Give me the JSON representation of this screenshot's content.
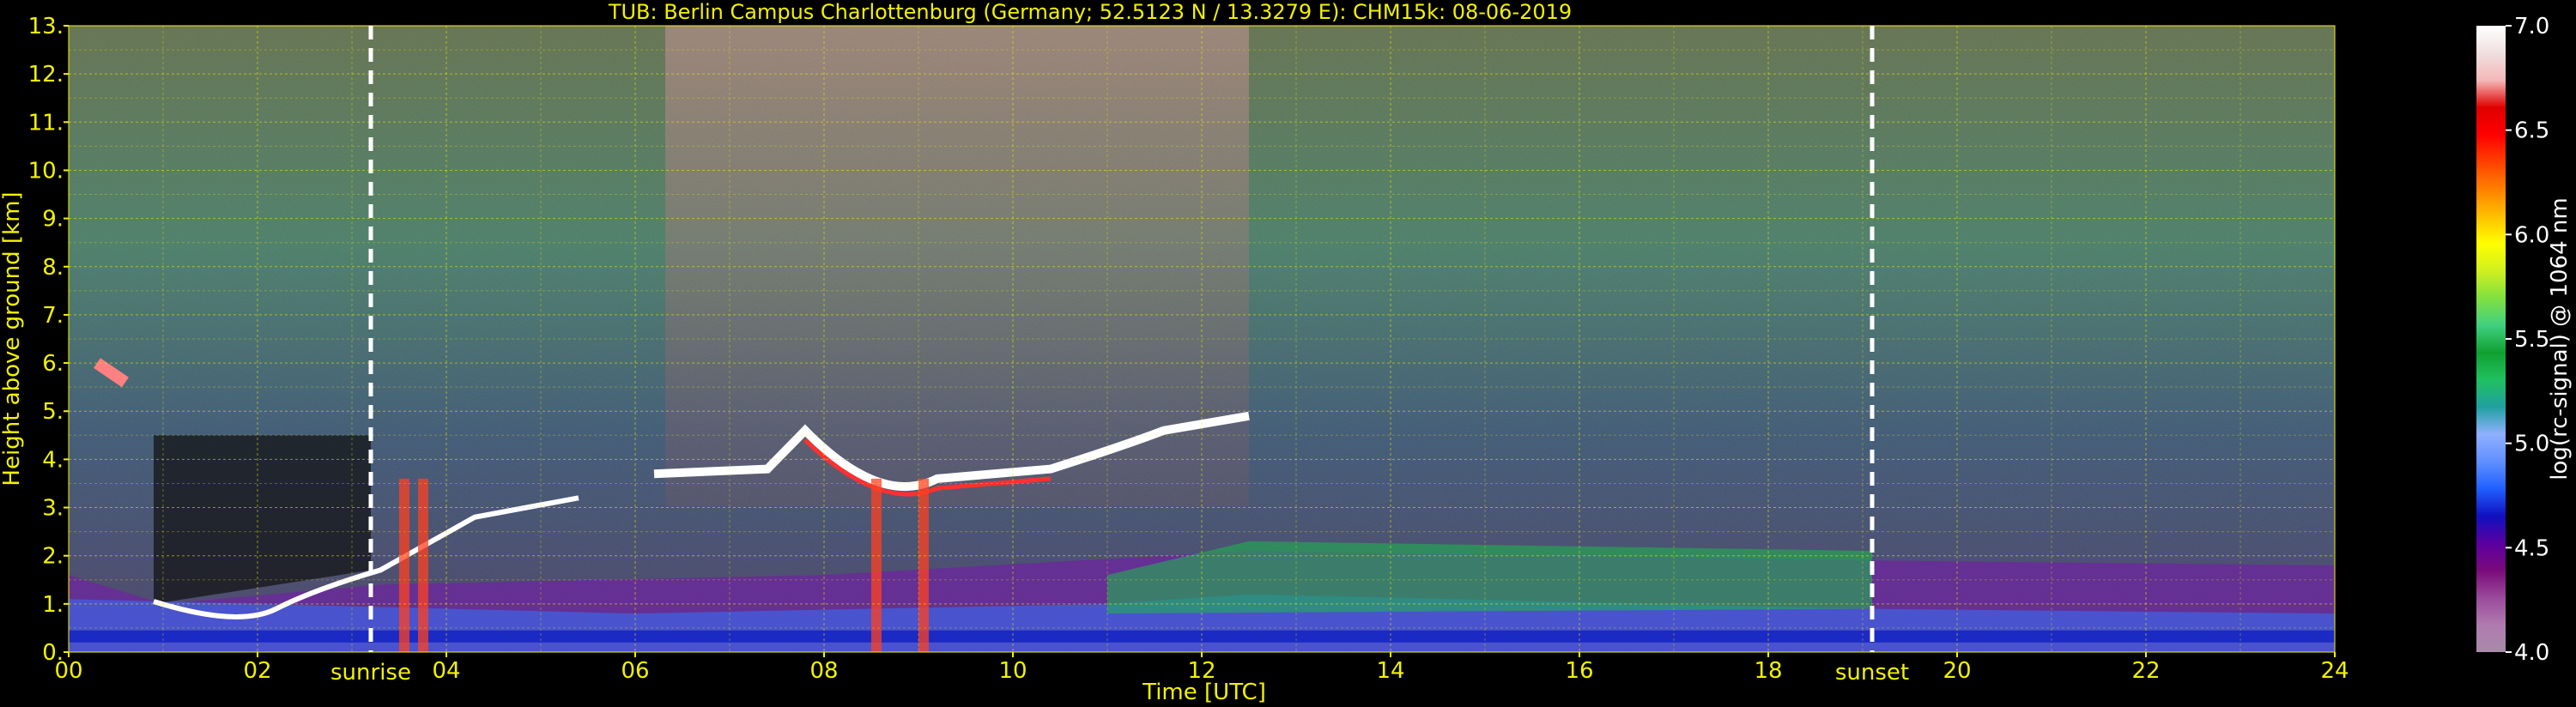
{
  "chart_data": {
    "type": "heatmap",
    "title": "TUB: Berlin Campus Charlottenburg (Germany; 52.5123 N / 13.3279 E):    CHM15k: 08-06-2019",
    "xlabel": "Time [UTC]",
    "ylabel": "Height above ground [km]",
    "xlim": [
      0,
      24
    ],
    "ylim": [
      0,
      13
    ],
    "x_ticks": [
      "00",
      "02",
      "04",
      "06",
      "08",
      "10",
      "12",
      "14",
      "16",
      "18",
      "20",
      "22",
      "24"
    ],
    "y_ticks": [
      "0.",
      "1.",
      "2.",
      "3.",
      "4.",
      "5.",
      "6.",
      "7.",
      "8.",
      "9.",
      "10.",
      "11.",
      "12.",
      "13."
    ],
    "grid": true,
    "annotations": [
      {
        "label": "sunrise",
        "time_utc": 3.2
      },
      {
        "label": "sunset",
        "time_utc": 19.1
      }
    ],
    "colorbar": {
      "label": "log(rc-signal) @ 1064 nm",
      "range": [
        4.0,
        7.0
      ],
      "ticks": [
        "4.0",
        "4.5",
        "5.0",
        "5.5",
        "6.0",
        "6.5",
        "7.0"
      ],
      "colors": [
        "#a88ca8",
        "#b07ab0",
        "#9a4a9a",
        "#7a0a7a",
        "#5a00a0",
        "#1010c0",
        "#2060ff",
        "#6090ff",
        "#90b0ff",
        "#20a0a0",
        "#20c060",
        "#10a030",
        "#40d080",
        "#80e040",
        "#d0f020",
        "#ffff00",
        "#ffc000",
        "#ff8000",
        "#ff4000",
        "#ff0000",
        "#e00000",
        "#f4b8b8",
        "#f0e0e0",
        "#ffffff"
      ]
    },
    "features": [
      {
        "name": "cloud layer",
        "t_start": 0.7,
        "t_end": 5.5,
        "height_km_start": 0.6,
        "height_km_end": 3.3
      },
      {
        "name": "cloud layer",
        "t_start": 6.2,
        "t_end": 12.5,
        "height_km_start": 3.6,
        "height_km_end": 5.0
      },
      {
        "name": "boundary layer top",
        "t_start": 12.5,
        "t_end": 19.1,
        "height_km": 2.1
      }
    ]
  }
}
